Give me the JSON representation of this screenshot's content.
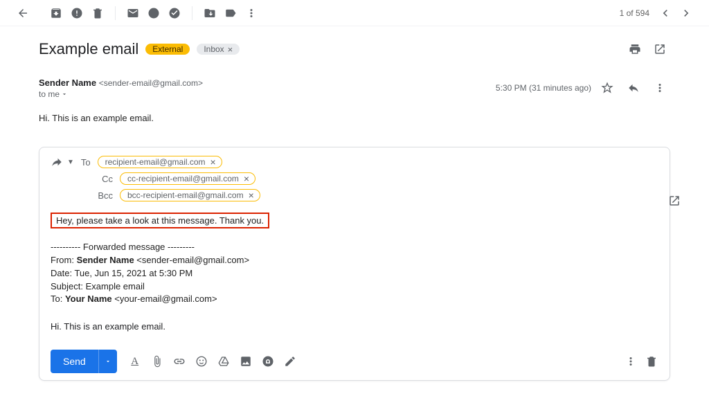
{
  "toolbar": {
    "counter": "1 of 594"
  },
  "subject": {
    "text": "Example email",
    "external_label": "External",
    "inbox_label": "Inbox"
  },
  "header": {
    "sender_name": "Sender Name",
    "sender_email": "<sender-email@gmail.com>",
    "to_line": "to me",
    "time": "5:30 PM (31 minutes ago)"
  },
  "body": {
    "text": "Hi. This is an example email."
  },
  "compose": {
    "to_label": "To",
    "cc_label": "Cc",
    "bcc_label": "Bcc",
    "to_chip": "recipient-email@gmail.com",
    "cc_chip": "cc-recipient-email@gmail.com",
    "bcc_chip": "bcc-recipient-email@gmail.com",
    "highlight_msg": "Hey, please take a look at this message. Thank you.",
    "fwd_header": "---------- Forwarded message ---------",
    "fwd_from_label": "From:",
    "fwd_from_name": "Sender Name",
    "fwd_from_email": "<sender-email@gmail.com>",
    "fwd_date_label": "Date:",
    "fwd_date_value": "Tue, Jun 15, 2021 at 5:30 PM",
    "fwd_subject_label": "Subject:",
    "fwd_subject_value": "Example email",
    "fwd_to_label": "To:",
    "fwd_to_name": "Your Name",
    "fwd_to_email": "<your-email@gmail.com>",
    "fwd_body": "Hi. This is an example email.",
    "send_label": "Send"
  }
}
